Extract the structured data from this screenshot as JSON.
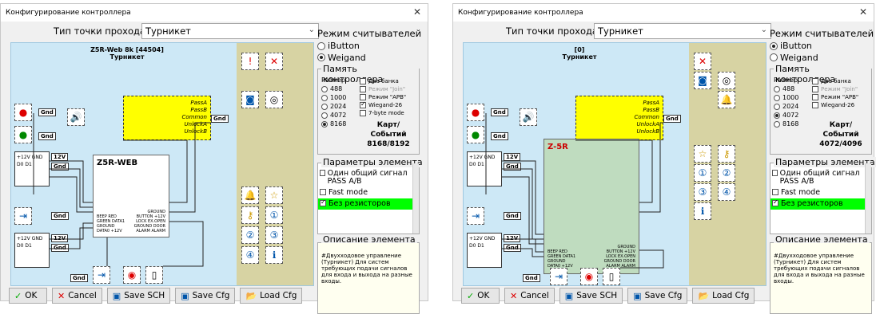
{
  "windows": [
    {
      "title": "Конфигурирование контроллера",
      "type_label": "Тип точки прохода",
      "type_value": "Турникет",
      "canvas_title": "Z5R-Web 8k [44504]",
      "canvas_subtitle": "Турникет",
      "board_label": "Z5R-WEB",
      "readers_mode": {
        "label": "Режим считывателей",
        "options": [
          "iButton",
          "Weigand"
        ],
        "selected": "Weigand"
      },
      "memory": {
        "label": "Память контроллера",
        "size_label": "Размер",
        "sizes": [
          "488",
          "1000",
          "2024",
          "4072",
          "8168"
        ],
        "selected": "8168",
        "checks": [
          {
            "label": "Два банка",
            "checked": false,
            "disabled": false
          },
          {
            "label": "Режим \"Join\"",
            "checked": false,
            "disabled": true
          },
          {
            "label": "Режим \"APB\"",
            "checked": false,
            "disabled": false
          },
          {
            "label": "Wiegand-26",
            "checked": true,
            "disabled": false
          },
          {
            "label": "7-byte mode",
            "checked": false,
            "disabled": false
          }
        ],
        "cards_label": "Карт/Событий",
        "cards_value": "8168/8192"
      },
      "params": {
        "label": "Параметры элемента",
        "items": [
          {
            "label": "Один общий сигнал PASS A/B",
            "checked": false
          },
          {
            "label": "Fast mode",
            "checked": false
          },
          {
            "label": "Без резисторов",
            "checked": true
          }
        ]
      },
      "description": {
        "label": "Описание элемента",
        "text": "#Двухходовое управление (Турникет) Для систем требующих подачи сигналов для входа и выхода на разные входы."
      }
    },
    {
      "title": "Конфигурирование контроллера",
      "type_label": "Тип точки прохода",
      "type_value": "Турникет",
      "canvas_title": "[0]",
      "canvas_subtitle": "Турникет",
      "board_label": "Z-5R",
      "readers_mode": {
        "label": "Режим считывателей",
        "options": [
          "iButton",
          "Weigand"
        ],
        "selected": "iButton"
      },
      "memory": {
        "label": "Память контроллера",
        "size_label": "Размер",
        "sizes": [
          "488",
          "1000",
          "2024",
          "4072",
          "8168"
        ],
        "selected": "4072",
        "checks": [
          {
            "label": "Два банка",
            "checked": false,
            "disabled": false
          },
          {
            "label": "Режим \"Join\"",
            "checked": false,
            "disabled": true
          },
          {
            "label": "Режим \"APB\"",
            "checked": false,
            "disabled": false
          },
          {
            "label": "Wiegand-26",
            "checked": false,
            "disabled": false
          }
        ],
        "cards_label": "Карт/Событий",
        "cards_value": "4072/4096"
      },
      "params": {
        "label": "Параметры элемента",
        "items": [
          {
            "label": "Один общий сигнал PASS A/B",
            "checked": false
          },
          {
            "label": "Fast mode",
            "checked": false
          },
          {
            "label": "Без резисторов",
            "checked": true
          }
        ]
      },
      "description": {
        "label": "Описание элемента",
        "text": "#Двухходовое управление (Турникет) Для систем требующих подачи сигналов для входа и выхода на разные входы."
      }
    }
  ],
  "buttons": {
    "ok": "OK",
    "cancel": "Cancel",
    "save_sch": "Save SCH",
    "save_cfg": "Save Cfg",
    "load_cfg": "Load Cfg"
  },
  "labels": {
    "gnd": "Gnd",
    "v12": "12V",
    "pass_a": "PassA",
    "pass_b": "PassB",
    "common": "Common",
    "unlock_a": "UnlockA",
    "unlock_b": "UnlockB",
    "reader_pins": "+12V GND D0 D1",
    "board_pins_left": "BEEP RED GREEN DATA1 GROUND DATA0 +12V",
    "board_pins_right": "GROUND BUTTON +12V LOCK EX.OPEN GROUND DOOR ALARM ALARM"
  },
  "colors": {
    "canvas": "#cde8f6",
    "olive": "#d7d3a3",
    "highlight": "#00ff00",
    "yellow": "#ffff00",
    "board": "#ffffff"
  }
}
